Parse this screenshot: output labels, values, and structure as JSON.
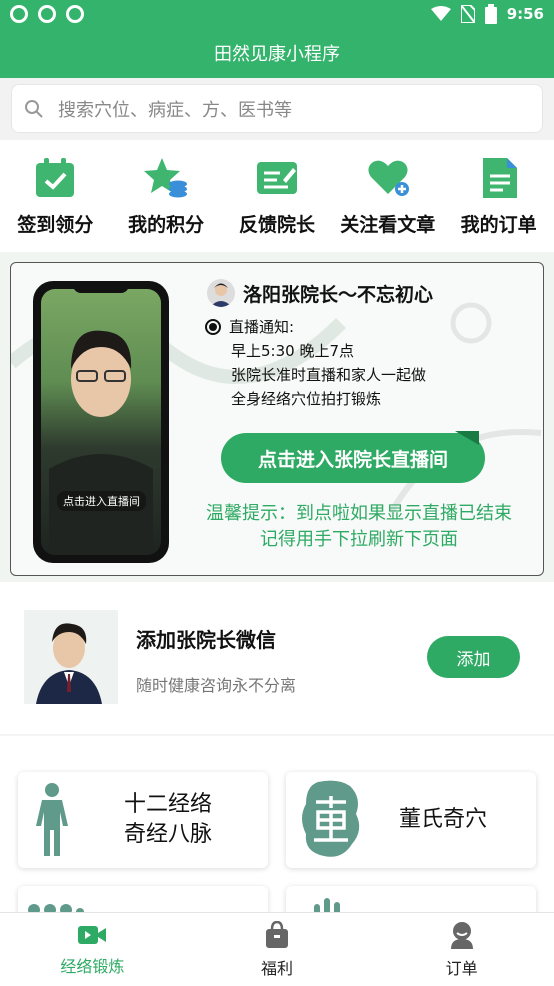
{
  "status_bar": {
    "time": "9:56"
  },
  "app": {
    "title": "田然见康小程序"
  },
  "search": {
    "placeholder": "搜索穴位、病症、方、医书等"
  },
  "quick_actions": [
    {
      "label": "签到领分",
      "icon": "calendar-check-icon"
    },
    {
      "label": "我的积分",
      "icon": "star-coins-icon"
    },
    {
      "label": "反馈院长",
      "icon": "edit-note-icon"
    },
    {
      "label": "关注看文章",
      "icon": "heart-plus-icon"
    },
    {
      "label": "我的订单",
      "icon": "document-icon"
    }
  ],
  "banner": {
    "title": "洛阳张院长～不忘初心",
    "notice_label": "直播通知:",
    "notice_lines": [
      "早上5:30  晚上7点",
      "张院长准时直播和家人一起做",
      "全身经络穴位拍打锻炼"
    ],
    "phone_caption": "点击进入直播间",
    "live_button": "点击进入张院长直播间",
    "tip_line1": "温馨提示：到点啦如果显示直播已结束",
    "tip_line2": "记得用手下拉刷新下页面"
  },
  "wechat": {
    "name": "添加张院长微信",
    "subtitle": "随时健康咨询永不分离",
    "add_label": "添加"
  },
  "cards": [
    {
      "line1": "十二经络",
      "line2": "奇经八脉",
      "icon": "human-body-icon"
    },
    {
      "line1": "董氏奇穴",
      "icon": "dong-seal-icon"
    }
  ],
  "tabs": [
    {
      "label": "经络锻炼",
      "icon": "video-icon",
      "active": true
    },
    {
      "label": "福利",
      "icon": "gift-bag-icon",
      "active": false
    },
    {
      "label": "订单",
      "icon": "user-icon",
      "active": false
    }
  ],
  "colors": {
    "brand": "#33b36b",
    "accent": "#2faa64"
  }
}
